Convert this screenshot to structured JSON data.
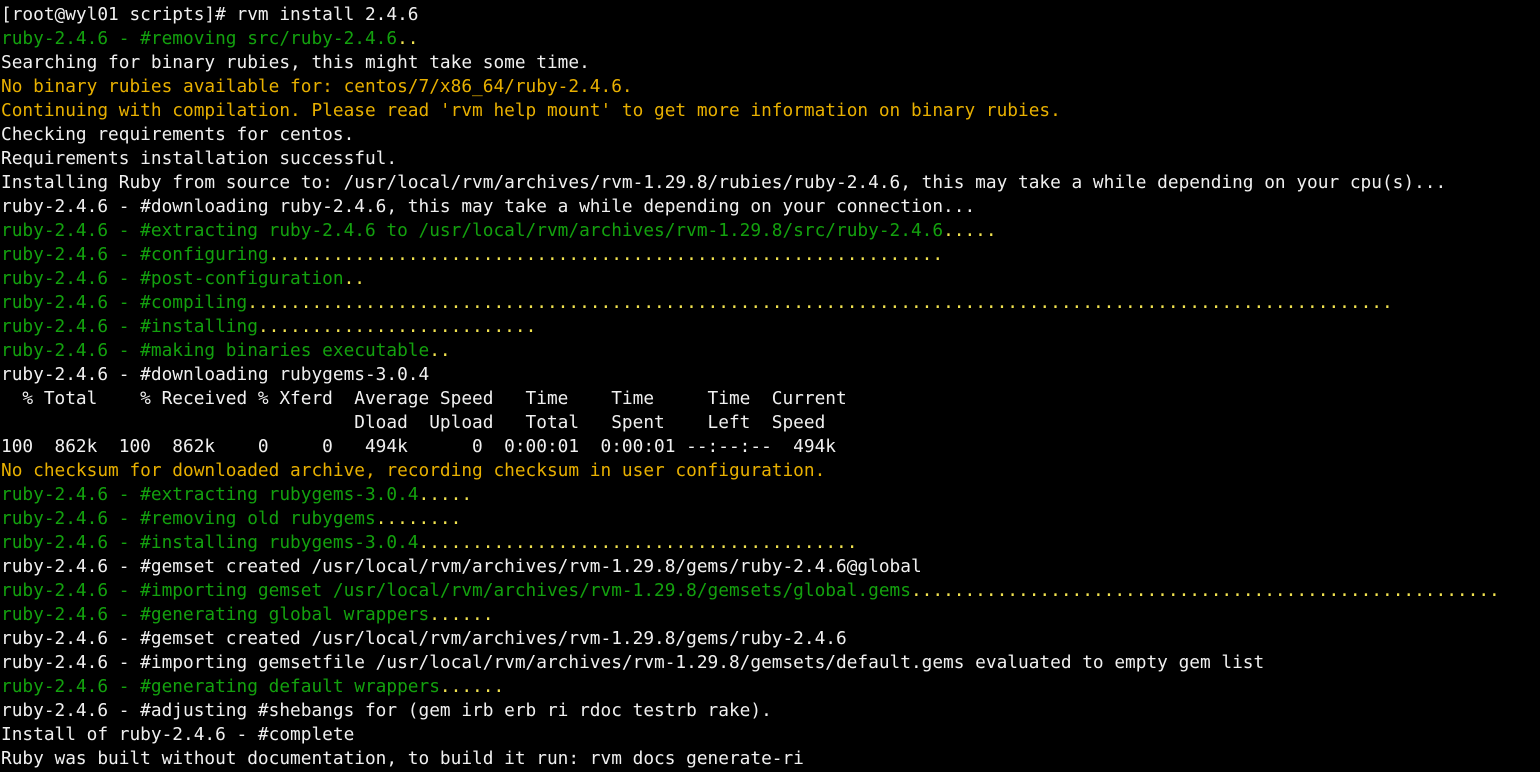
{
  "terminal": {
    "colors": {
      "background": "#000000",
      "white": "#f0f0f0",
      "green": "#13a10e",
      "yellow": "#e8b000",
      "dots": "#f2e34f"
    },
    "lines": [
      {
        "color": "white",
        "text": "[root@wyl01 scripts]# rvm install 2.4.6"
      },
      {
        "color": "green",
        "text": "ruby-2.4.6 - #removing src/ruby-2.4.6",
        "dots": ".."
      },
      {
        "color": "white",
        "text": "Searching for binary rubies, this might take some time."
      },
      {
        "color": "yellow",
        "text": "No binary rubies available for: centos/7/x86_64/ruby-2.4.6."
      },
      {
        "color": "yellow",
        "text": "Continuing with compilation. Please read 'rvm help mount' to get more information on binary rubies."
      },
      {
        "color": "white",
        "text": "Checking requirements for centos."
      },
      {
        "color": "white",
        "text": "Requirements installation successful."
      },
      {
        "color": "white",
        "text": "Installing Ruby from source to: /usr/local/rvm/archives/rvm-1.29.8/rubies/ruby-2.4.6, this may take a while depending on your cpu(s)..."
      },
      {
        "color": "white",
        "text": "ruby-2.4.6 - #downloading ruby-2.4.6, this may take a while depending on your connection..."
      },
      {
        "color": "green",
        "text": "ruby-2.4.6 - #extracting ruby-2.4.6 to /usr/local/rvm/archives/rvm-1.29.8/src/ruby-2.4.6",
        "dots": "....."
      },
      {
        "color": "green",
        "text": "ruby-2.4.6 - #configuring",
        "dots": "..............................................................."
      },
      {
        "color": "green",
        "text": "ruby-2.4.6 - #post-configuration",
        "dots": ".."
      },
      {
        "color": "green",
        "text": "ruby-2.4.6 - #compiling",
        "dots": "..........................................................................................................."
      },
      {
        "color": "green",
        "text": "ruby-2.4.6 - #installing",
        "dots": ".........................."
      },
      {
        "color": "green",
        "text": "ruby-2.4.6 - #making binaries executable",
        "dots": ".."
      },
      {
        "color": "white",
        "text": "ruby-2.4.6 - #downloading rubygems-3.0.4"
      },
      {
        "color": "white",
        "text": "  % Total    % Received % Xferd  Average Speed   Time    Time     Time  Current"
      },
      {
        "color": "white",
        "text": "                                 Dload  Upload   Total   Spent    Left  Speed"
      },
      {
        "color": "white",
        "text": "100  862k  100  862k    0     0   494k      0  0:00:01  0:00:01 --:--:--  494k"
      },
      {
        "color": "yellow",
        "text": "No checksum for downloaded archive, recording checksum in user configuration."
      },
      {
        "color": "green",
        "text": "ruby-2.4.6 - #extracting rubygems-3.0.4",
        "dots": "....."
      },
      {
        "color": "green",
        "text": "ruby-2.4.6 - #removing old rubygems",
        "dots": "........"
      },
      {
        "color": "green",
        "text": "ruby-2.4.6 - #installing rubygems-3.0.4",
        "dots": "........................................."
      },
      {
        "color": "white",
        "text": "ruby-2.4.6 - #gemset created /usr/local/rvm/archives/rvm-1.29.8/gems/ruby-2.4.6@global"
      },
      {
        "color": "green",
        "text": "ruby-2.4.6 - #importing gemset /usr/local/rvm/archives/rvm-1.29.8/gemsets/global.gems",
        "dots": "......................................................."
      },
      {
        "color": "green",
        "text": "ruby-2.4.6 - #generating global wrappers",
        "dots": "......"
      },
      {
        "color": "white",
        "text": "ruby-2.4.6 - #gemset created /usr/local/rvm/archives/rvm-1.29.8/gems/ruby-2.4.6"
      },
      {
        "color": "white",
        "text": "ruby-2.4.6 - #importing gemsetfile /usr/local/rvm/archives/rvm-1.29.8/gemsets/default.gems evaluated to empty gem list"
      },
      {
        "color": "green",
        "text": "ruby-2.4.6 - #generating default wrappers",
        "dots": "......"
      },
      {
        "color": "white",
        "text": "ruby-2.4.6 - #adjusting #shebangs for (gem irb erb ri rdoc testrb rake)."
      },
      {
        "color": "white",
        "text": "Install of ruby-2.4.6 - #complete"
      },
      {
        "color": "white",
        "text": "Ruby was built without documentation, to build it run: rvm docs generate-ri"
      }
    ]
  }
}
